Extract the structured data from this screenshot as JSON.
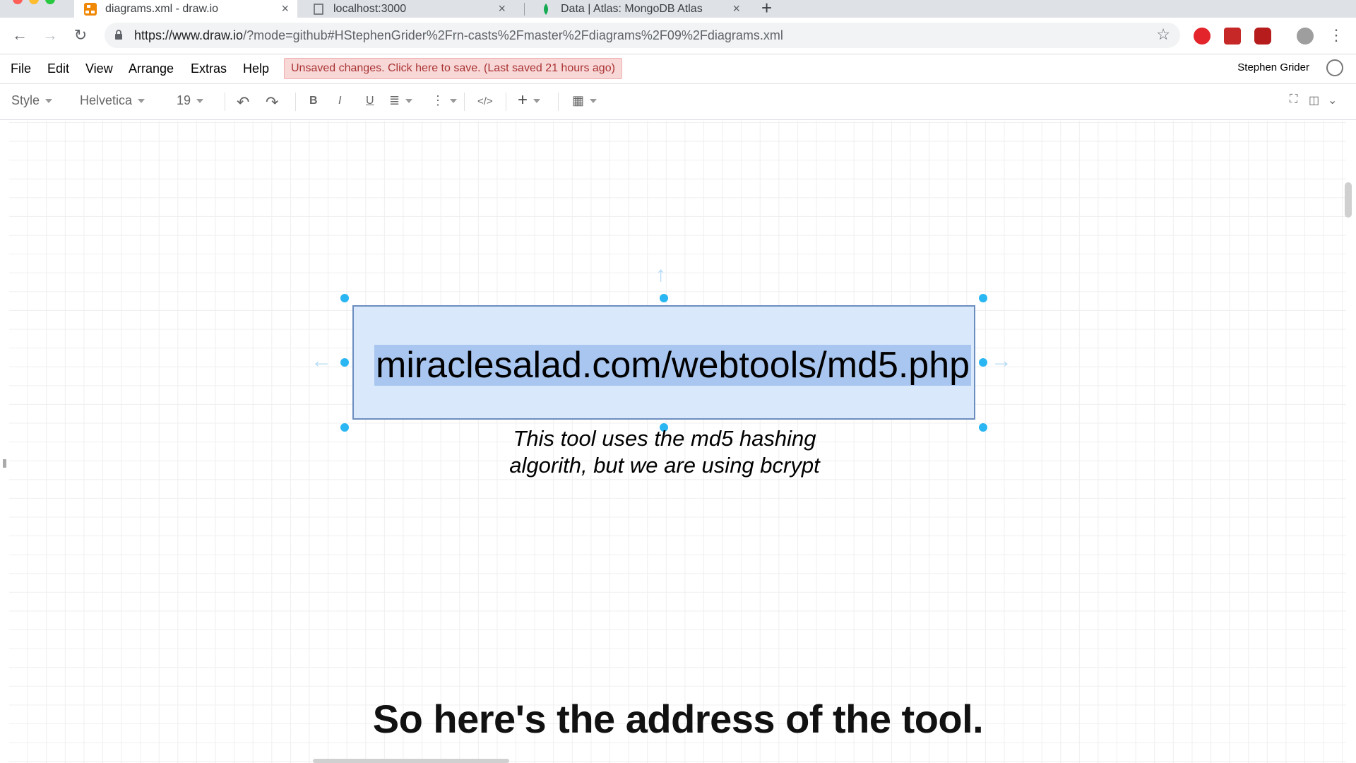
{
  "browser": {
    "tabs": [
      {
        "title": "diagrams.xml - draw.io",
        "active": true
      },
      {
        "title": "localhost:3000",
        "active": false
      },
      {
        "title": "Data | Atlas: MongoDB Atlas",
        "active": false
      }
    ],
    "url_host": "https://www.draw.io",
    "url_path": "/?mode=github#HStephenGrider%2Frn-casts%2Fmaster%2Fdiagrams%2F09%2Fdiagrams.xml"
  },
  "menubar": {
    "items": [
      "File",
      "Edit",
      "View",
      "Arrange",
      "Extras",
      "Help"
    ],
    "unsaved_notice": "Unsaved changes. Click here to save. (Last saved 21 hours ago)",
    "user": "Stephen Grider"
  },
  "toolbar": {
    "style": "Style",
    "font": "Helvetica",
    "size": "19",
    "bold": "B",
    "italic": "I",
    "underline": "U",
    "html": "</>",
    "insert": "+"
  },
  "diagram": {
    "box_text": "miraclesalad.com/webtools/md5.php",
    "caption_line1": "This tool uses the md5 hashing",
    "caption_line2": "algorith, but we are using bcrypt"
  },
  "subtitle": "So here's the address of the tool.",
  "colors": {
    "selection_handle": "#29b6f2",
    "shape_fill": "#dae8fc",
    "shape_stroke": "#6c8ebf",
    "text_highlight": "#a9c6f0"
  }
}
